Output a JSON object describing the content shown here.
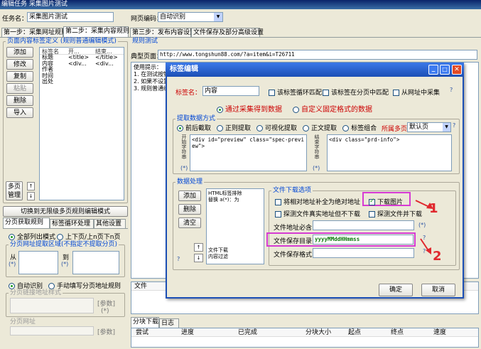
{
  "window": {
    "title": "编辑任务 采集图片测试"
  },
  "task": {
    "name_label": "任务名：",
    "name_value": "采集图片测试",
    "encoding_label": "网页编码：",
    "encoding_value": "自动识别"
  },
  "main_tabs": [
    "第一步：采集网址规则",
    "第二步：采集内容规则",
    "第三步：发布内容设置",
    "文件保存及部分高级设置"
  ],
  "left": {
    "group_title": "页面内容标签定义",
    "group_hint": "(规则普通编辑模式)",
    "buttons": [
      "添加",
      "修改",
      "复制",
      "粘贴",
      "删除",
      "导入"
    ],
    "col_headers": [
      "标签名",
      "开...",
      "结束..."
    ],
    "rows": [
      [
        "标题",
        "<title>",
        "</title>"
      ],
      [
        "内容",
        "<div...",
        "<div..."
      ],
      [
        "作者",
        "",
        ""
      ],
      [
        "时间",
        "",
        ""
      ],
      [
        "出处",
        "",
        ""
      ]
    ],
    "multi_page_btn": "多页管理",
    "switch_btn": "切换到无限级多页规则编辑模式",
    "sub_tabs": [
      "分页获取规则",
      "标签循环处理",
      "其他设置"
    ],
    "radio_all": "全部列出模式",
    "radio_prevnext": "上下页/上n页下n页",
    "area_title": "分页网址提取区域(不指定不提取分页)",
    "from_label": "从",
    "to_label": "到",
    "star": "(*)",
    "radio_auto": "自动识别",
    "radio_manual": "手动填写分页地址规则",
    "url_style_label": "分页链接地址样式",
    "param": "[参数]",
    "star2": "(*)",
    "page_url_label": "分页网址"
  },
  "right": {
    "rule_test": "规则测试",
    "typical_label": "典型页面：",
    "typical_url": "http://www.tongshun88.com/?a=item&i=T26711",
    "tips_title": "使用提示：",
    "tips": [
      "1. 在测试按钮",
      "2. 如果不设置",
      "3. 规则普通编"
    ],
    "file_col": "文件",
    "bottom_tabs": [
      "分块下载",
      "日志"
    ],
    "table_headers": [
      "尝试",
      "进度",
      "已完成",
      "分块大小",
      "起点",
      "终点",
      "速度"
    ]
  },
  "dialog": {
    "title": "标签编辑",
    "tag_name_label": "标签名：",
    "tag_name_value": "内容",
    "chk_loop": "该标签循环匹配",
    "chk_page": "该标签在分页中匹配",
    "chk_url": "从网址中采集",
    "radio_collect": "通过采集得到数据",
    "radio_custom": "自定义固定格式的数据",
    "extract_title": "提取数据方式",
    "extract_opts": [
      "前后截取",
      "正则提取",
      "可视化提取",
      "正文提取",
      "标签组合"
    ],
    "multi_page_label": "所属多页:",
    "multi_page_value": "默认页",
    "start_label": "开始字符串",
    "start_code": "<div id=\"preview\" class=\"spec-preview\">",
    "end_label": "结束字符串",
    "end_code": "<div class=\"prd-info\">",
    "data_title": "数据处理",
    "data_buttons": [
      "添加",
      "删除",
      "清空"
    ],
    "data_list": [
      "HTML标签排除",
      "替换 a(*)：为"
    ],
    "data_list2": [
      "文件下载",
      "内容过滤"
    ],
    "download_title": "文件下载选项",
    "chk_relative": "将相对地址补全为绝对地址",
    "chk_download_img": "下载图片",
    "chk_probe": "探测文件真实地址但不下载",
    "chk_probe2": "探测文件并下载",
    "prefix_label": "文件地址必含",
    "save_dir_label": "文件保存目录",
    "save_dir_value": "yyyyMMddHHmmss",
    "save_fmt_label": "文件保存格式",
    "ok": "确定",
    "cancel": "取消",
    "help": "?"
  },
  "annotations": {
    "one": "1",
    "two": "2",
    "color": "#e0282e",
    "box_color": "#d63bd3"
  }
}
